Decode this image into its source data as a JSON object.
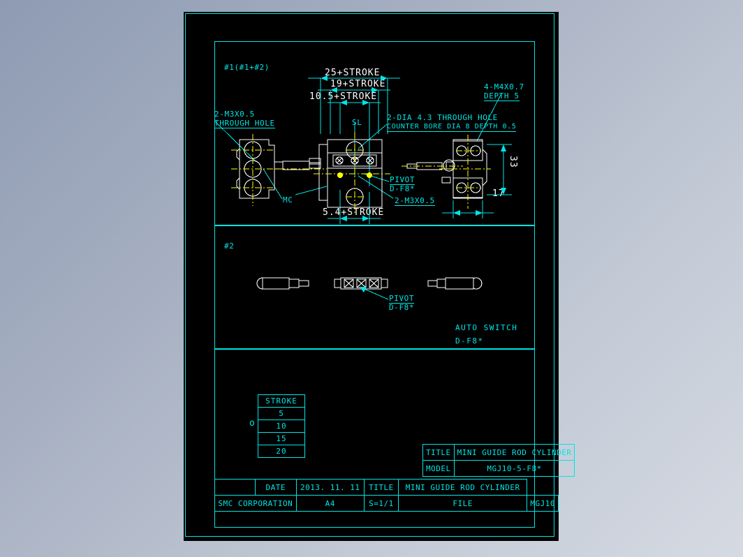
{
  "sheet": {
    "panel1": {
      "tag": "#1(#1+#2)",
      "dims": {
        "d25": "25+STROKE",
        "d19": "19+STROKE",
        "d105": "10.5+STROKE",
        "d54": "5.4+STROKE",
        "d33": "33",
        "d17": "17"
      },
      "notes": {
        "m3_through": "2-M3X0.5",
        "m3_through2": "THROUGH HOLE",
        "dia43": "2-DIA 4.3 THROUGH HOLE",
        "counterbore": "COUNTER BORE DIA 8 DEPTH 0.5",
        "m4": "4-M4X0.7",
        "m4_depth": "DEPTH 5",
        "pivot": "PIVOT",
        "pivot_model": "D-F8*",
        "m3_2": "2-M3X0.5",
        "mc": "MC",
        "sl": "SL"
      }
    },
    "panel2": {
      "tag": "#2",
      "pivot": "PIVOT",
      "pivot_model": "D-F8*",
      "auto_switch": "AUTO SWITCH",
      "auto_switch_model": "D-F8*"
    },
    "panel3": {
      "stroke_table": {
        "header": "STROKE",
        "rows": [
          "5",
          "10",
          "15",
          "20"
        ],
        "selected_marker": "o"
      },
      "info_table": {
        "title_label": "TITLE",
        "title_value": "MINI GUIDE ROD CYLINDER",
        "model_label": "MODEL",
        "model_value": "MGJ10-5-F8*"
      }
    },
    "titleblock": {
      "date_label": "DATE",
      "date_value": "2013. 11. 11",
      "title_label": "TITLE",
      "title_value": "MINI GUIDE ROD CYLINDER",
      "company": "SMC CORPORATION",
      "size": "A4",
      "scale": "S=1/1",
      "file_label": "FILE",
      "file_value": "MGJ10"
    }
  },
  "colors": {
    "line": "#00e5e5",
    "part": "#ffffff",
    "center": "#ffff00",
    "background": "#000000"
  }
}
